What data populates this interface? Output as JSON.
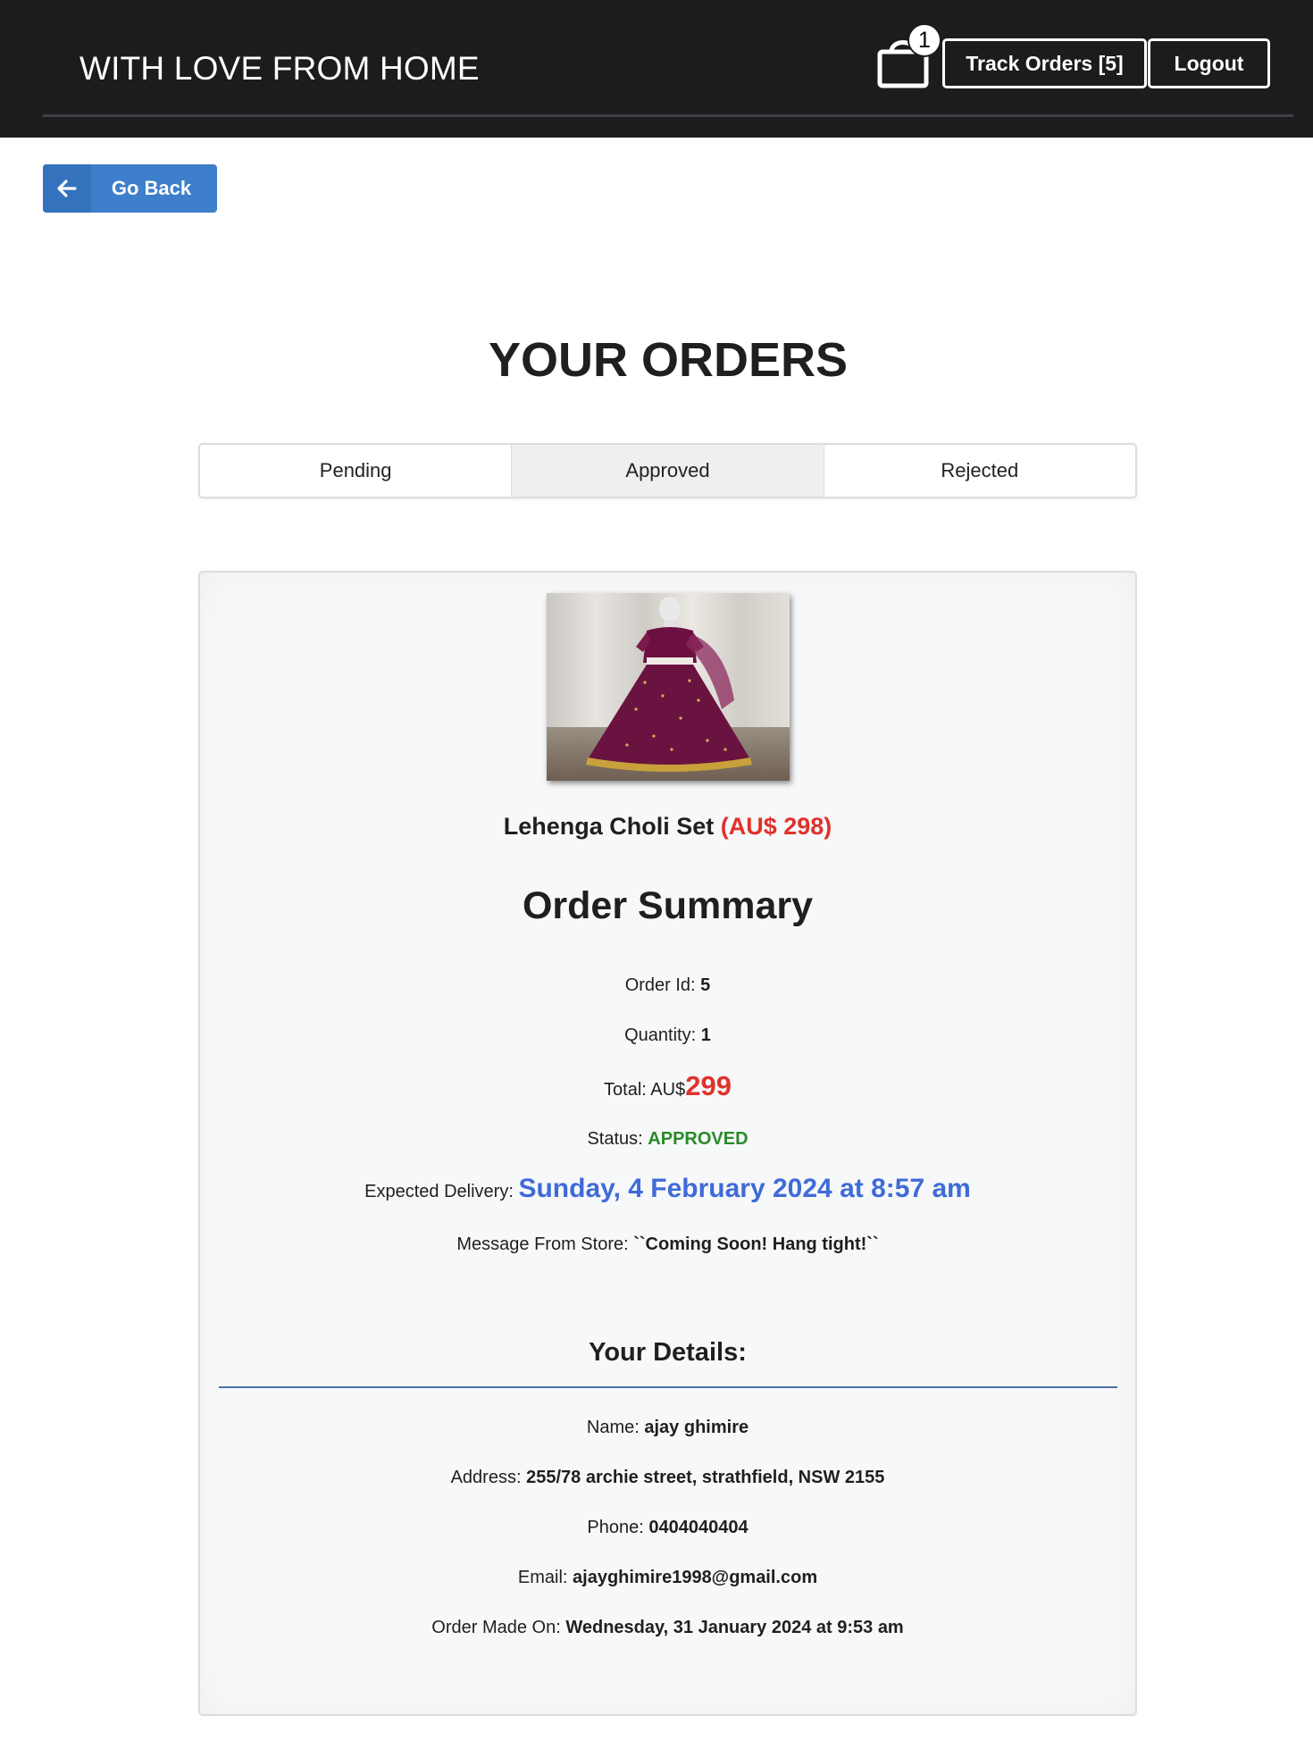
{
  "header": {
    "brand": "WITH LOVE FROM HOME",
    "cart_count": "1",
    "track_orders_label": "Track Orders [5]",
    "logout_label": "Logout"
  },
  "nav": {
    "go_back_label": "Go Back"
  },
  "page": {
    "title": "YOUR ORDERS"
  },
  "tabs": [
    {
      "label": "Pending",
      "active": false
    },
    {
      "label": "Approved",
      "active": true
    },
    {
      "label": "Rejected",
      "active": false
    }
  ],
  "order": {
    "product_name": "Lehenga Choli Set",
    "product_price": "(AU$ 298)",
    "summary_title": "Order Summary",
    "order_id_label": "Order Id:",
    "order_id": "5",
    "quantity_label": "Quantity:",
    "quantity": "1",
    "total_label": "Total: AU$",
    "total": "299",
    "status_label": "Status:",
    "status": "APPROVED",
    "delivery_label": "Expected Delivery:",
    "delivery": "Sunday, 4 February 2024 at 8:57 am",
    "message_label": "Message From Store:",
    "message": "``Coming Soon! Hang tight!``"
  },
  "details": {
    "title": "Your Details:",
    "name_label": "Name:",
    "name": "ajay ghimire",
    "address_label": "Address:",
    "address": "255/78 archie street, strathfield, NSW 2155",
    "phone_label": "Phone:",
    "phone": "0404040404",
    "email_label": "Email:",
    "email": "ajayghimire1998@gmail.com",
    "order_made_label": "Order Made On:",
    "order_made": "Wednesday, 31 January 2024 at 9:53 am"
  },
  "colors": {
    "header_bg": "#1b1c1d",
    "go_back_blue": "#3e7fcb",
    "price_red": "#e0322b",
    "status_green": "#2a8a28",
    "delivery_blue": "#3f6bd6"
  },
  "icons": {
    "cart": "shopping-bag-icon",
    "back": "arrow-left-icon"
  }
}
